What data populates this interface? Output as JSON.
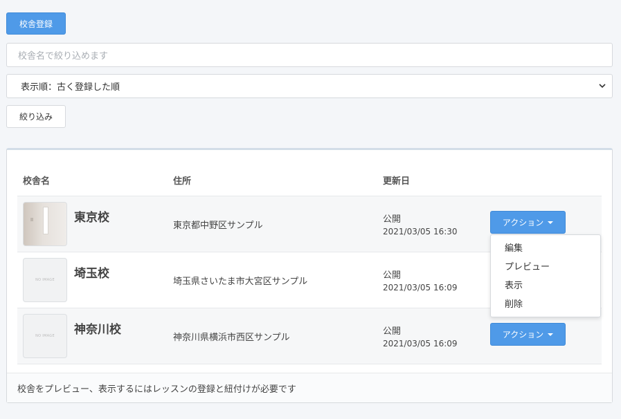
{
  "toolbar": {
    "register_label": "校舎登録",
    "search_placeholder": "校舎名で絞り込めます",
    "sort_value": "表示順：古く登録した順",
    "filter_label": "絞り込み"
  },
  "table": {
    "headers": {
      "name": "校舎名",
      "address": "住所",
      "updated": "更新日"
    },
    "action_label": "アクション",
    "rows": [
      {
        "name": "東京校",
        "address": "東京都中野区サンプル",
        "status": "公開",
        "date": "2021/03/05 16:30",
        "image": "photo"
      },
      {
        "name": "埼玉校",
        "address": "埼玉県さいたま市大宮区サンプル",
        "status": "公開",
        "date": "2021/03/05 16:09",
        "image": "NO IMAGE"
      },
      {
        "name": "神奈川校",
        "address": "神奈川県横浜市西区サンプル",
        "status": "公開",
        "date": "2021/03/05 16:09",
        "image": "NO IMAGE"
      }
    ]
  },
  "dropdown": {
    "items": [
      "編集",
      "プレビュー",
      "表示",
      "削除"
    ]
  },
  "footer": {
    "note": "校舎をプレビュー、表示するにはレッスンの登録と紐付けが必要です"
  },
  "colors": {
    "primary": "#4f9ae8",
    "background": "#f4f6f9"
  }
}
